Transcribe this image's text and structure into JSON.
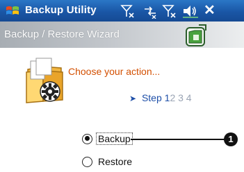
{
  "titlebar": {
    "app_title": "Backup Utility",
    "icons": [
      "windows-start-icon",
      "signal-icon",
      "connectivity-icon",
      "signal-off-icon",
      "volume-icon",
      "close-icon"
    ],
    "close_label": "✕"
  },
  "wizard": {
    "header_title": "Backup / Restore Wizard",
    "header_icon": "backup-folder-icon"
  },
  "main": {
    "prompt": "Choose your action...",
    "step_arrow": "➤",
    "step_label": "Step",
    "current_step": "1",
    "other_steps": "2 3 4"
  },
  "options": [
    {
      "label": "Backup",
      "selected": true
    },
    {
      "label": "Restore",
      "selected": false
    }
  ],
  "callout": {
    "number": "1"
  },
  "colors": {
    "titlebar": "#1a56a6",
    "prompt": "#d34f00",
    "step_active": "#1e4fa8",
    "step_inactive": "#9aa4b4"
  }
}
